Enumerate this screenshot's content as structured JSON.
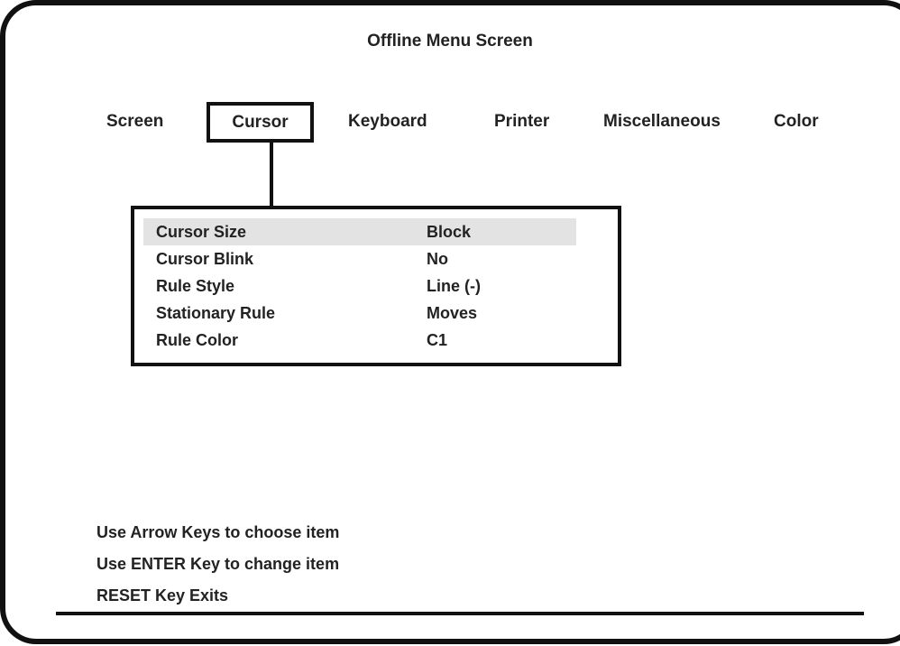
{
  "screen": {
    "title": "Offline Menu Screen"
  },
  "tabs": [
    {
      "label": "Screen",
      "selected": false
    },
    {
      "label": "Cursor",
      "selected": true
    },
    {
      "label": "Keyboard",
      "selected": false
    },
    {
      "label": "Printer",
      "selected": false
    },
    {
      "label": "Miscellaneous",
      "selected": false
    },
    {
      "label": "Color",
      "selected": false
    }
  ],
  "submenu": {
    "highlighted_index": 0,
    "items": [
      {
        "label": "Cursor Size",
        "value": "Block"
      },
      {
        "label": "Cursor Blink",
        "value": "No"
      },
      {
        "label": "Rule Style",
        "value": "Line (-)"
      },
      {
        "label": "Stationary Rule",
        "value": "Moves"
      },
      {
        "label": "Rule Color",
        "value": "C1"
      }
    ]
  },
  "instructions": [
    "Use Arrow Keys to choose item",
    "Use ENTER Key to change item",
    "RESET Key Exits"
  ],
  "colors": {
    "text": "#222222",
    "border": "#111111",
    "highlight": "#e3e3e3",
    "background": "#ffffff"
  }
}
